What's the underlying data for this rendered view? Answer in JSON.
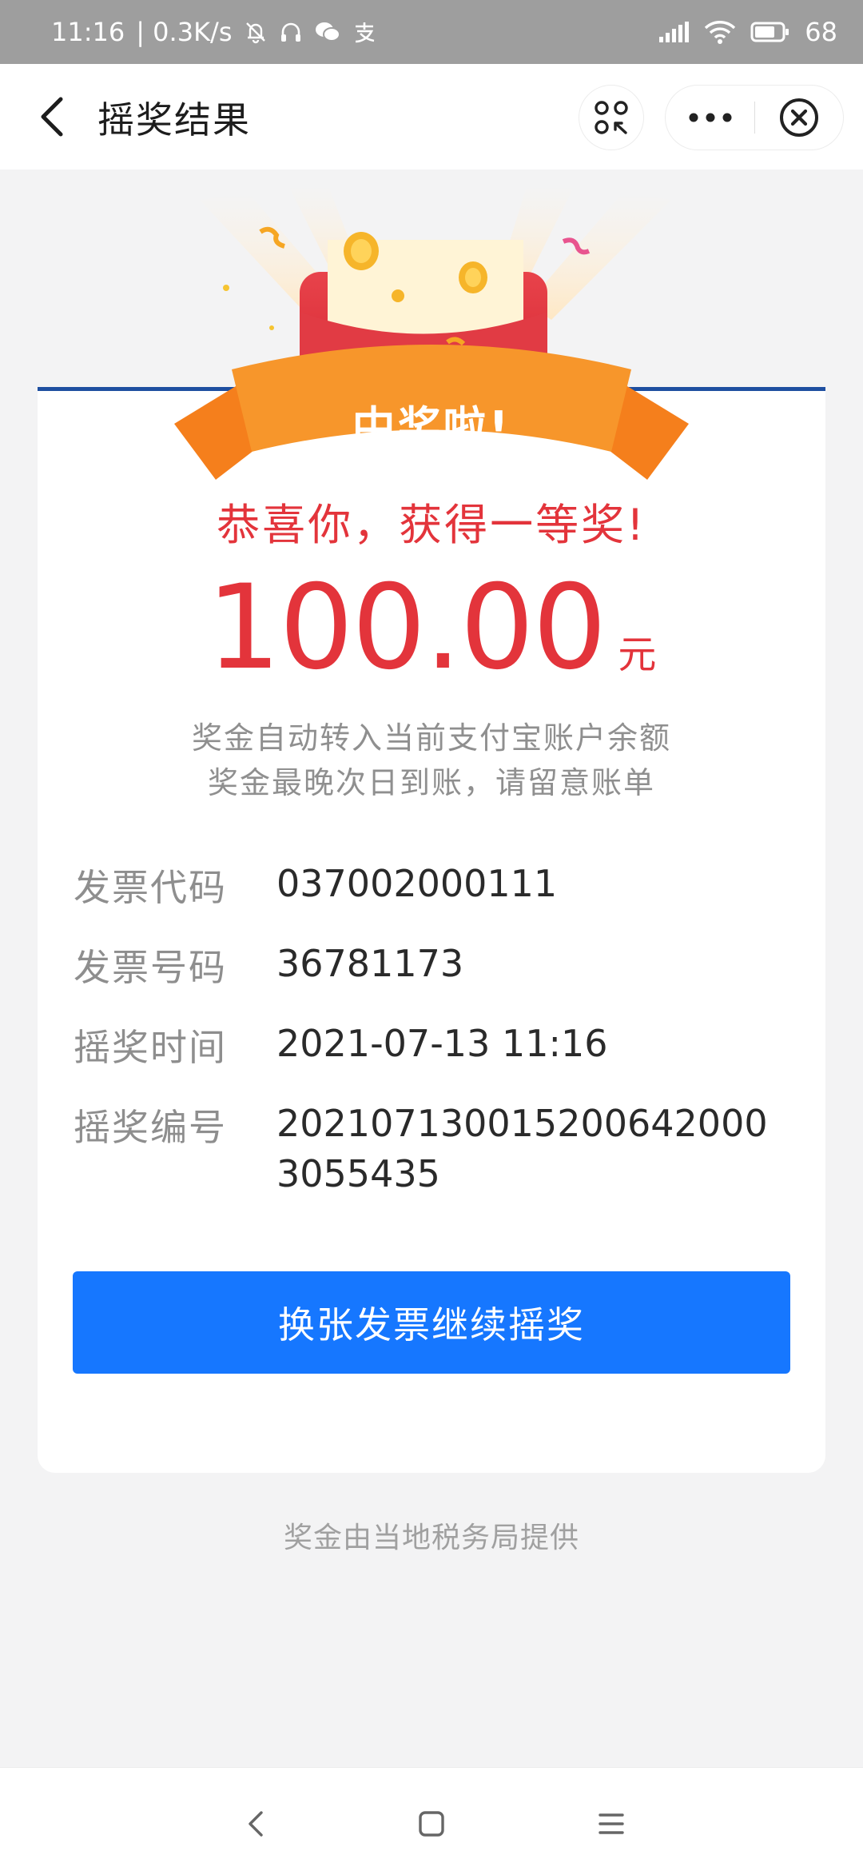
{
  "status_bar": {
    "time": "11:16",
    "network_speed": "| 0.3K/s",
    "battery": "68"
  },
  "titlebar": {
    "title": "摇奖结果"
  },
  "banner": {
    "ribbon_text": "中奖啦!"
  },
  "result": {
    "headline": "恭喜你，获得一等奖!",
    "amount": "100.00",
    "unit": "元",
    "note_line1": "奖金自动转入当前支付宝账户余额",
    "note_line2": "奖金最晚次日到账，请留意账单"
  },
  "details": [
    {
      "label": "发票代码",
      "value": "037002000111"
    },
    {
      "label": "发票号码",
      "value": "36781173"
    },
    {
      "label": "摇奖时间",
      "value": "2021-07-13 11:16"
    },
    {
      "label": "摇奖编号",
      "value": "2021071300152006420003055435"
    }
  ],
  "actions": {
    "continue_label": "换张发票继续摇奖"
  },
  "footer": {
    "provider_note": "奖金由当地税务局提供"
  },
  "colors": {
    "accent_blue": "#1677ff",
    "prize_red": "#e3343b",
    "ribbon_orange": "#f58a1f"
  }
}
